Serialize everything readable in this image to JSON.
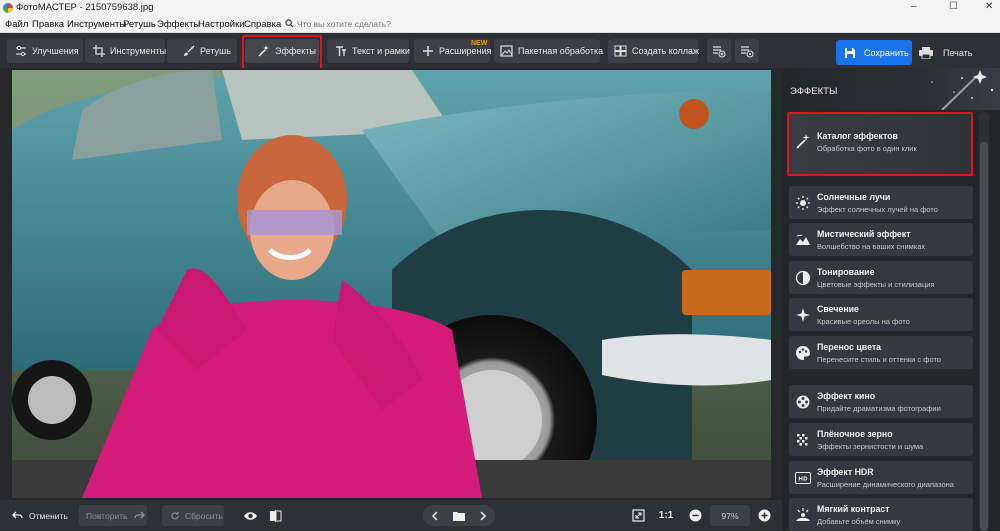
{
  "window": {
    "title": "ФотоМАСТЕР - 2150759638.jpg",
    "minimize": "–",
    "maximize": "☐",
    "close": "✕"
  },
  "menu": {
    "items": [
      "Файл",
      "Правка",
      "Инструменты",
      "Ретушь",
      "Эффекты",
      "Настройки",
      "Справка"
    ],
    "search_placeholder": "Что вы хотите сделать?"
  },
  "toolbar": {
    "tabs": [
      {
        "label": "Улучшения",
        "icon": "sliders-icon"
      },
      {
        "label": "Инструменты",
        "icon": "crop-icon"
      },
      {
        "label": "Ретушь",
        "icon": "brush-icon"
      },
      {
        "label": "Эффекты",
        "icon": "magic-wand-icon",
        "active": true
      },
      {
        "label": "Текст и рамки",
        "icon": "text-icon"
      },
      {
        "label": "Расширения",
        "icon": "plus-icon"
      },
      {
        "label": "Пакетная обработка",
        "icon": "batch-icon"
      },
      {
        "label": "Создать коллаж",
        "icon": "collage-icon"
      }
    ],
    "new_badge": "NEW",
    "save_label": "Сохранить",
    "print_label": "Печать"
  },
  "bottom": {
    "undo_label": "Отменить",
    "redo_label": "Повторить",
    "reset_label": "Сбросить",
    "ratio_label": "1:1",
    "zoom_value": "97%"
  },
  "sidebar": {
    "title": "ЭФФЕКТЫ",
    "catalog": {
      "title": "Каталог эффектов",
      "subtitle": "Обработка фото в один клик",
      "icon": "magic-wand-icon"
    },
    "items": [
      {
        "title": "Солнечные лучи",
        "subtitle": "Эффект солнечных лучей на фото",
        "icon": "sun-icon"
      },
      {
        "title": "Мистический эффект",
        "subtitle": "Волшебство на ваших снимках",
        "icon": "mountain-icon"
      },
      {
        "title": "Тонирование",
        "subtitle": "Цветовые эффекты и стилизация",
        "icon": "half-circle-icon"
      },
      {
        "title": "Свечение",
        "subtitle": "Красивые ореолы на фото",
        "icon": "sparkle-icon"
      },
      {
        "title": "Перенос цвета",
        "subtitle": "Перенесите стиль и оттенки с фото",
        "icon": "palette-icon"
      },
      {
        "title": "Эффект кино",
        "subtitle": "Придайте драматизма фотографии",
        "icon": "film-reel-icon"
      },
      {
        "title": "Плёночное зерно",
        "subtitle": "Эффекты зернистости и шума",
        "icon": "grain-icon"
      },
      {
        "title": "Эффект HDR",
        "subtitle": "Расширение динамического диапазона",
        "icon": "hdr-icon"
      },
      {
        "title": "Мягкий контраст",
        "subtitle": "Добавьте объём снимку",
        "icon": "contrast-icon"
      }
    ]
  },
  "colors": {
    "accent": "#1a73e8",
    "highlight": "#e0161e",
    "panel": "#24262a",
    "card": "#35383e"
  }
}
